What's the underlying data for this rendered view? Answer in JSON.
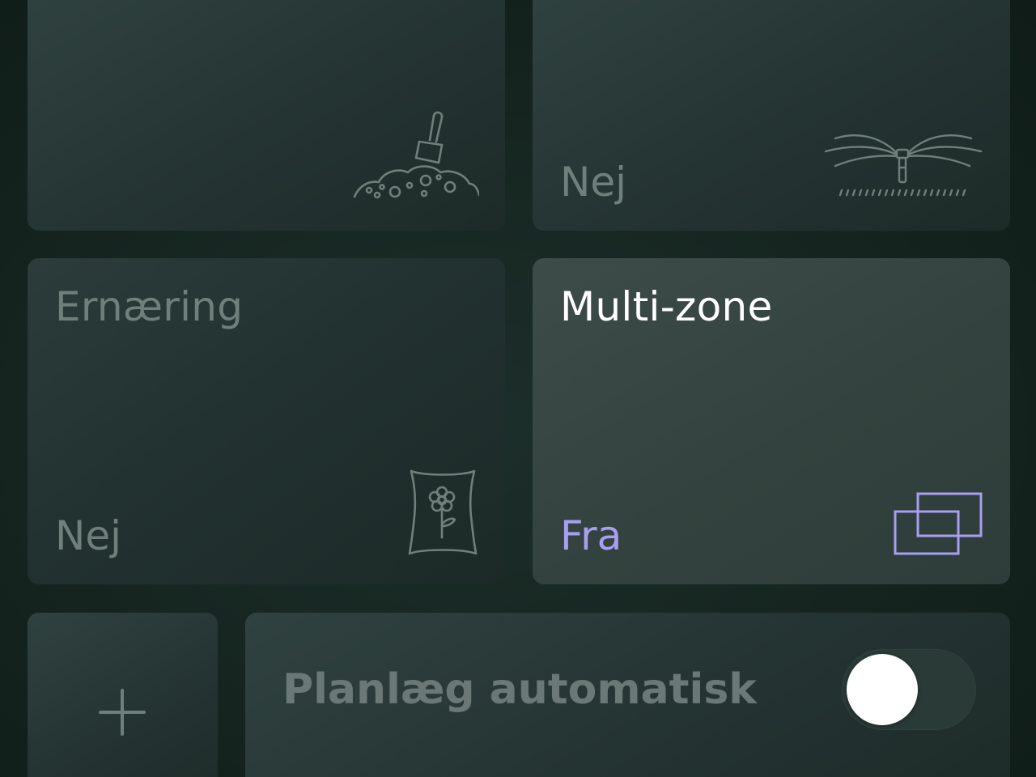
{
  "tiles": {
    "soil": {
      "title": "",
      "value": "",
      "icon": "soil-shovel-icon"
    },
    "sprinkler": {
      "title": "",
      "value": "Nej",
      "icon": "sprinkler-icon"
    },
    "nutrition": {
      "title": "Ernæring",
      "value": "Nej",
      "icon": "fertilizer-bag-icon"
    },
    "multizone": {
      "title": "Multi-zone",
      "value": "Fra",
      "icon": "multi-zone-icon"
    }
  },
  "add": {
    "icon": "plus-icon"
  },
  "auto_schedule": {
    "label": "Planlæg automatisk",
    "toggle_on": false
  },
  "colors": {
    "accent": "#a79ff0",
    "active_title": "#ffffff",
    "muted_text": "#6f807b",
    "knob": "#ffffff"
  }
}
